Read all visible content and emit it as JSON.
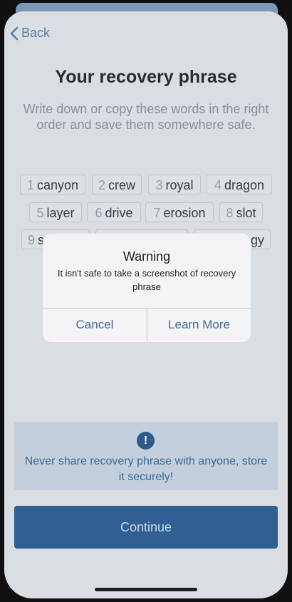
{
  "nav": {
    "back_label": "Back"
  },
  "header": {
    "title": "Your recovery phrase",
    "subtitle": "Write down or copy these words in the right order and save them somewhere safe."
  },
  "words": [
    {
      "num": "1",
      "word": "canyon"
    },
    {
      "num": "2",
      "word": "crew"
    },
    {
      "num": "3",
      "word": "royal"
    },
    {
      "num": "4",
      "word": "dragon"
    },
    {
      "num": "5",
      "word": "layer"
    },
    {
      "num": "6",
      "word": "drive"
    },
    {
      "num": "7",
      "word": "erosion"
    },
    {
      "num": "8",
      "word": "slot"
    },
    {
      "num": "9",
      "word": "s"
    },
    {
      "num": "",
      "word": ""
    },
    {
      "num": "",
      "word": "gy"
    }
  ],
  "dialog": {
    "title": "Warning",
    "message": "It isn't safe to take a screenshot of recovery phrase",
    "cancel_label": "Cancel",
    "learn_more_label": "Learn More"
  },
  "notice": {
    "icon": "!",
    "text": "Never share recovery phrase with anyone, store it securely!"
  },
  "footer": {
    "continue_label": "Continue"
  },
  "colors": {
    "accent": "#2f5f93",
    "link": "#5c7fa6",
    "dialog_button": "#3f6796"
  }
}
